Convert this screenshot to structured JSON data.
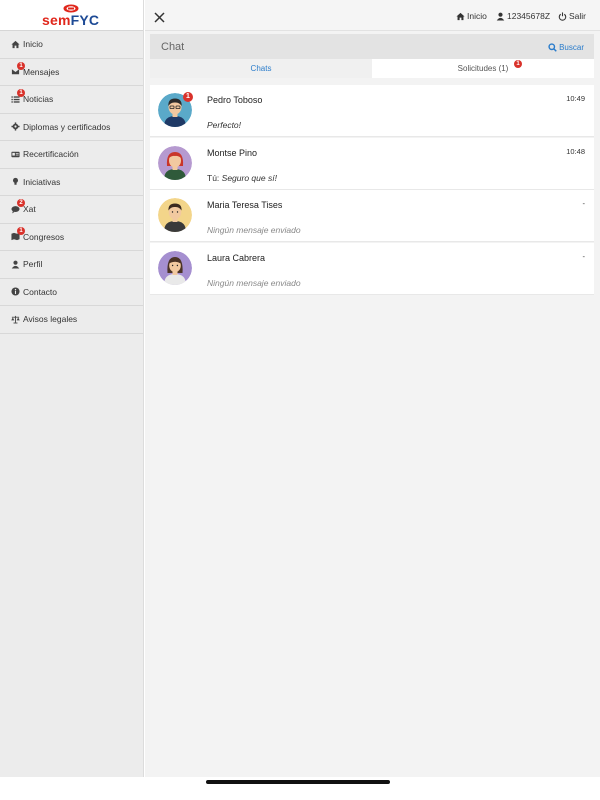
{
  "app": {
    "brand_part1": "sem",
    "brand_part2": "FYC"
  },
  "sidebar": {
    "items": [
      {
        "label": "Inicio",
        "icon": "home-icon"
      },
      {
        "label": "Mensajes",
        "icon": "envelope-icon",
        "badge": "1"
      },
      {
        "label": "Noticias",
        "icon": "list-icon",
        "badge": "1"
      },
      {
        "label": "Diplomas y certificados",
        "icon": "gear-icon"
      },
      {
        "label": "Recertificación",
        "icon": "id-card-icon"
      },
      {
        "label": "Iniciativas",
        "icon": "lightbulb-icon"
      },
      {
        "label": "Xat",
        "icon": "chat-bubble-icon",
        "badge": "2"
      },
      {
        "label": "Congresos",
        "icon": "map-icon",
        "badge": "1"
      },
      {
        "label": "Perfil",
        "icon": "user-icon"
      },
      {
        "label": "Contacto",
        "icon": "info-icon"
      },
      {
        "label": "Avisos legales",
        "icon": "scale-icon"
      }
    ]
  },
  "topbar": {
    "home_label": "Inicio",
    "user_id": "12345678Z",
    "logout_label": "Salir"
  },
  "chat": {
    "title": "Chat",
    "search_label": "Buscar",
    "tabs": [
      {
        "label": "Chats",
        "active": true
      },
      {
        "label": "Solicitudes (1)",
        "badge": "1"
      }
    ],
    "conversations": [
      {
        "name": "Pedro Toboso",
        "time": "10:49",
        "preview": "Perfecto!",
        "unread": "1",
        "avatar": "male-avatar-blue"
      },
      {
        "name": "Montse Pino",
        "time": "10:48",
        "prefix": "Tú: ",
        "preview": "Seguro que sí!",
        "avatar": "female-avatar-purple"
      },
      {
        "name": "Maria Teresa Tises",
        "time": "-",
        "preview": "Ningún mensaje enviado",
        "avatar": "male-avatar-yellow"
      },
      {
        "name": "Laura Cabrera",
        "time": "-",
        "preview": "Ningún mensaje enviado",
        "avatar": "female-avatar-purple"
      }
    ]
  },
  "colors": {
    "accent": "#2a7ccb",
    "badge": "#d9322b",
    "brand_red": "#e0261b",
    "brand_blue": "#1d4a95"
  }
}
